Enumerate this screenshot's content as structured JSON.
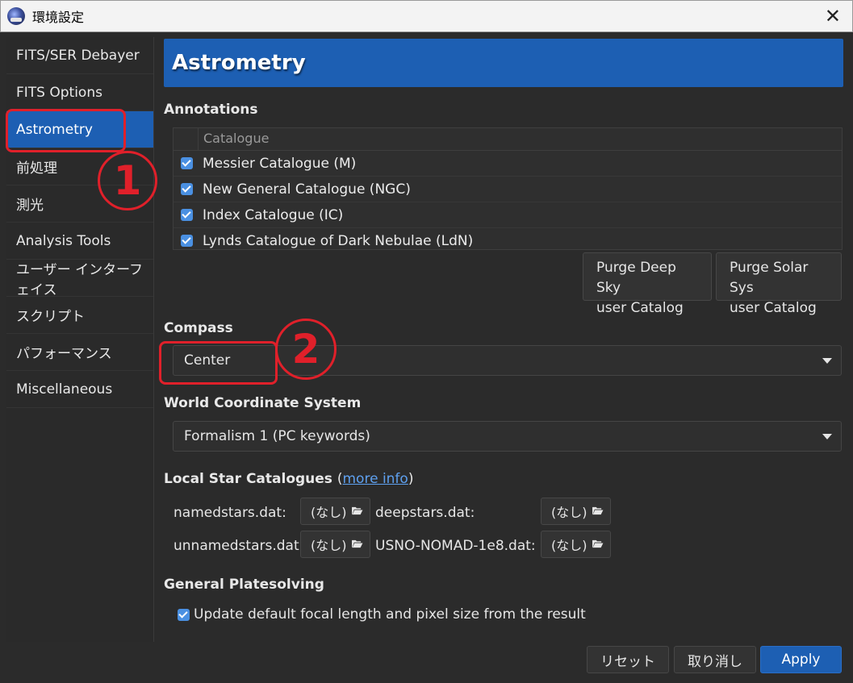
{
  "window": {
    "title": "環境設定",
    "close_glyph": "✕"
  },
  "sidebar": {
    "items": [
      {
        "label": "FITS/SER Debayer"
      },
      {
        "label": "FITS Options"
      },
      {
        "label": "Astrometry"
      },
      {
        "label": "前処理"
      },
      {
        "label": "測光"
      },
      {
        "label": "Analysis Tools"
      },
      {
        "label": "ユーザー インターフェイス"
      },
      {
        "label": "スクリプト"
      },
      {
        "label": "パフォーマンス"
      },
      {
        "label": "Miscellaneous"
      }
    ],
    "active_index": 2
  },
  "page": {
    "title": "Astrometry"
  },
  "annotations": {
    "section_title": "Annotations",
    "column_header": "Catalogue",
    "rows": [
      {
        "label": "Messier Catalogue (M)",
        "checked": true
      },
      {
        "label": "New General Catalogue (NGC)",
        "checked": true
      },
      {
        "label": "Index Catalogue (IC)",
        "checked": true
      },
      {
        "label": "Lynds Catalogue of Dark Nebulae (LdN)",
        "checked": true
      }
    ],
    "purge_deep_sky": {
      "line1": "Purge Deep Sky",
      "line2": "user Catalog"
    },
    "purge_solar_sys": {
      "line1": "Purge Solar Sys",
      "line2": "user Catalog"
    }
  },
  "compass": {
    "section_title": "Compass",
    "value": "Center"
  },
  "wcs": {
    "section_title": "World Coordinate System",
    "value": "Formalism 1 (PC keywords)"
  },
  "local_catalogues": {
    "section_title": "Local Star Catalogues",
    "paren_open": "(",
    "more_info": "more info",
    "paren_close": ")",
    "entries": [
      {
        "label": "namedstars.dat:",
        "value": "(なし)"
      },
      {
        "label": "deepstars.dat:",
        "value": "(なし)"
      },
      {
        "label": "unnamedstars.dat:",
        "value": "(なし)"
      },
      {
        "label": "USNO-NOMAD-1e8.dat:",
        "value": "(なし)"
      }
    ]
  },
  "platesolving": {
    "section_title": "General Platesolving",
    "update_option": {
      "label": "Update default focal length and pixel size from the result",
      "checked": true
    }
  },
  "buttons": {
    "reset": "リセット",
    "cancel": "取り消し",
    "apply": "Apply"
  },
  "markers": {
    "one": "1",
    "two": "2",
    "color": "#e0202a"
  },
  "colors": {
    "accent": "#1d5fb3",
    "background": "#2b2b2b",
    "checkbox": "#4a90e2",
    "link": "#5ea0ef"
  },
  "icons": {
    "app": "siril-app-icon",
    "folder": "folder-open-icon",
    "dropdown": "chevron-down-icon",
    "check": "checkmark-icon"
  }
}
